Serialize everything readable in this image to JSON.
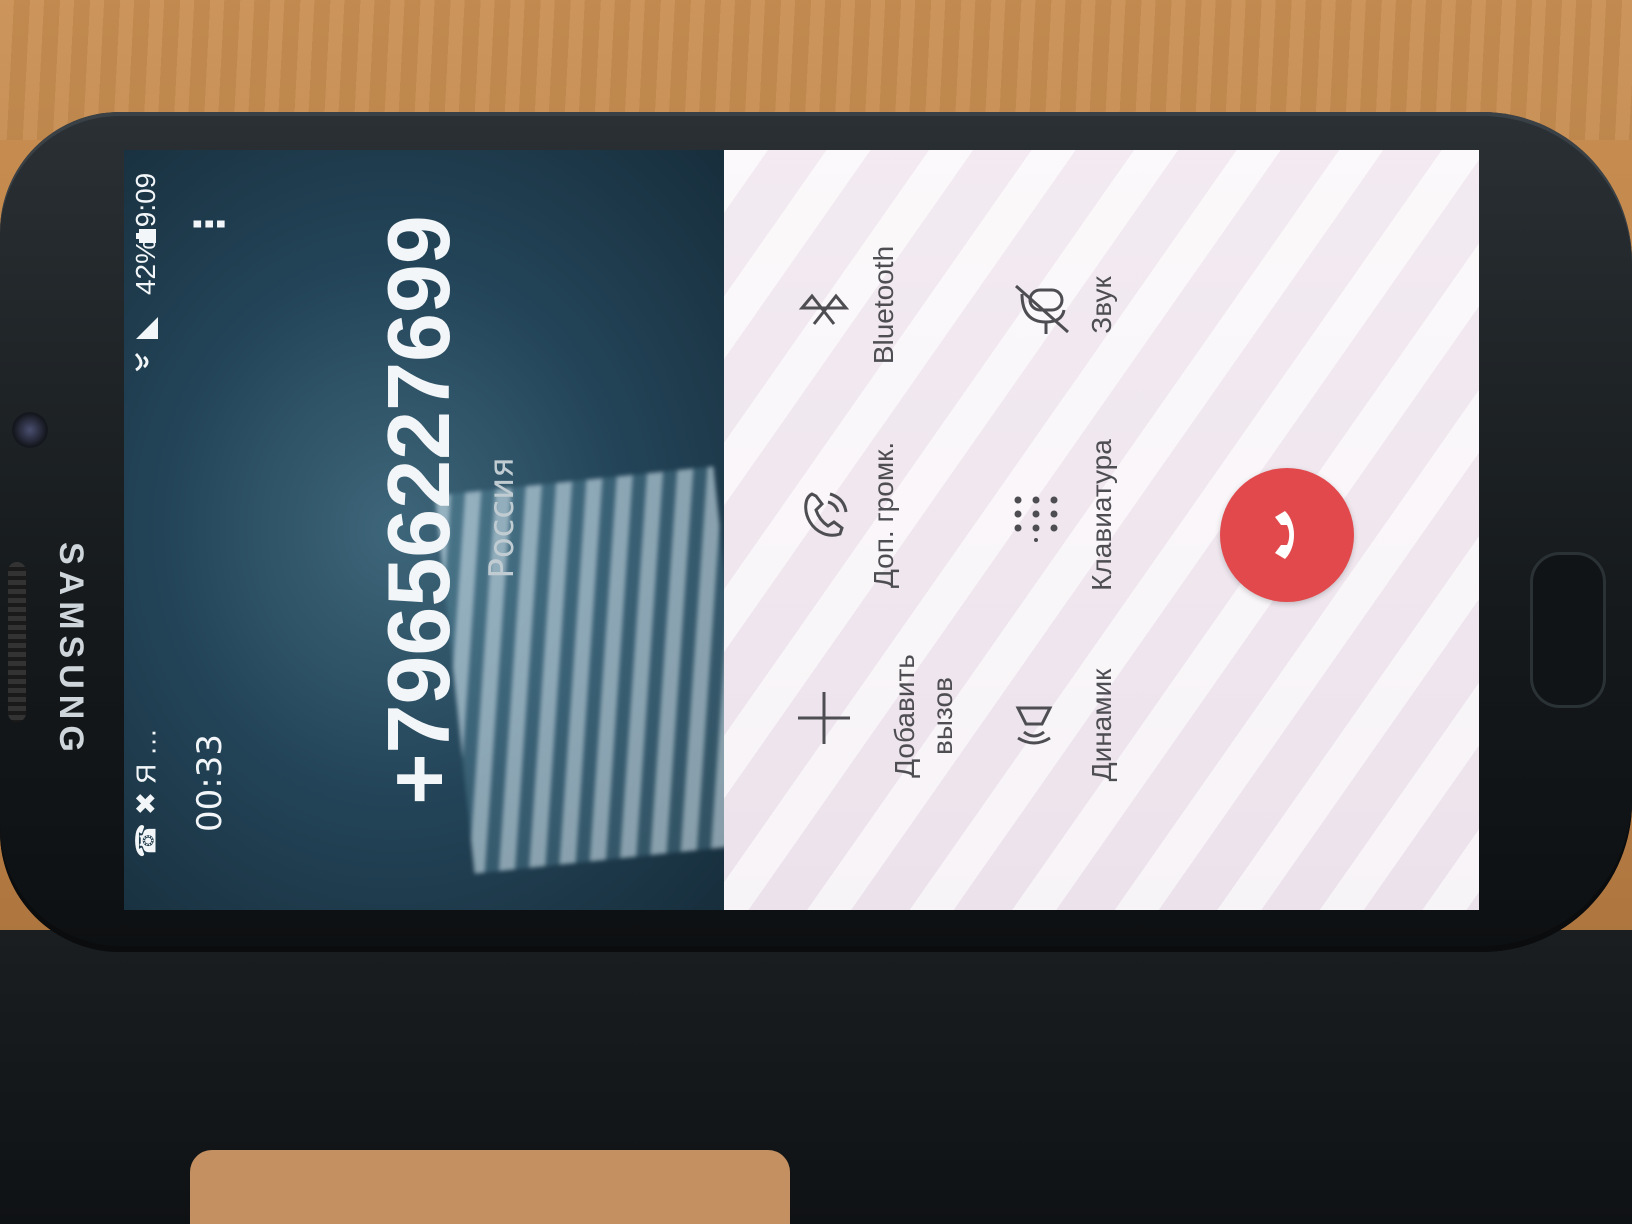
{
  "device": {
    "brand": "SAMSUNG"
  },
  "status_bar": {
    "left_icons": "☎ ✖ Я …",
    "battery": "42%",
    "time": "9:09"
  },
  "call": {
    "duration": "00:33",
    "number": "+79656227699",
    "region": "Россия",
    "menu_icon": "⋮"
  },
  "controls": {
    "add_call": "Добавить\nвызов",
    "extra_volume": "Доп. громк.",
    "bluetooth": "Bluetooth",
    "speaker": "Динамик",
    "keypad": "Клавиатура",
    "mute": "Звук"
  },
  "colors": {
    "end_call": "#e2494c",
    "control_gray": "#4d4d52",
    "call_bg": "#234458",
    "controls_bg": "#f3ecf2"
  }
}
